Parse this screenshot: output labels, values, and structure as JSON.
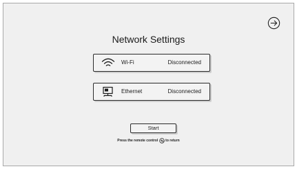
{
  "title": "Network Settings",
  "next_button": {
    "icon": "arrow-right-circle-icon"
  },
  "connections": [
    {
      "icon": "wifi-icon",
      "label": "Wi-Fi",
      "status": "Disconnected"
    },
    {
      "icon": "ethernet-icon",
      "label": "Ethernet",
      "status": "Disconnected"
    }
  ],
  "start_button": {
    "label": "Start"
  },
  "hint": {
    "before": "Press the remote control",
    "icon": "remote-back-icon",
    "after": "to return"
  }
}
